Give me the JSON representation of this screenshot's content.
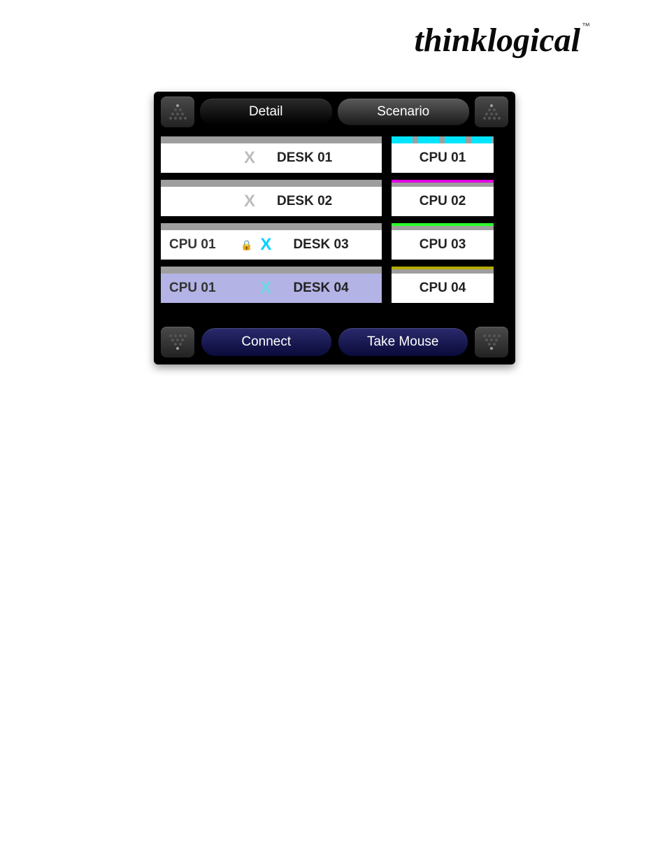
{
  "logo": "thinklogical",
  "logo_tm": "™",
  "tabs": {
    "detail": "Detail",
    "scenario": "Scenario"
  },
  "desks": [
    {
      "assigned": "",
      "x_active": false,
      "lock": false,
      "name": "DESK 01",
      "selected": false
    },
    {
      "assigned": "",
      "x_active": false,
      "lock": false,
      "name": "DESK 02",
      "selected": false
    },
    {
      "assigned": "CPU 01",
      "x_active": true,
      "lock": true,
      "name": "DESK 03",
      "selected": false
    },
    {
      "assigned": "CPU 01",
      "x_active": true,
      "lock": false,
      "name": "DESK 04",
      "selected": true
    }
  ],
  "cpus": [
    {
      "name": "CPU 01",
      "color": "#00e5ff"
    },
    {
      "name": "CPU 02",
      "color": "#e000e0"
    },
    {
      "name": "CPU 03",
      "color": "#2bff2b"
    },
    {
      "name": "CPU 04",
      "color": "#b5ab00"
    }
  ],
  "actions": {
    "connect": "Connect",
    "take_mouse": "Take Mouse"
  }
}
